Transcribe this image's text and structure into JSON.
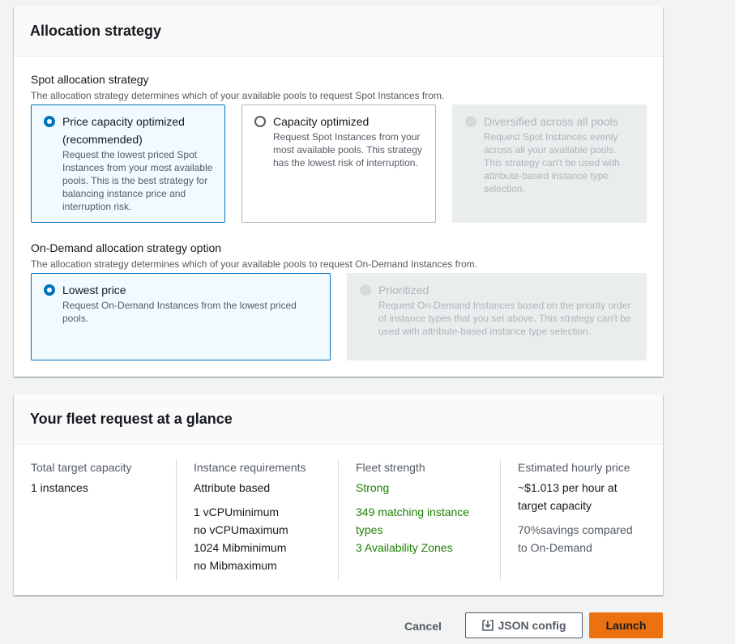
{
  "allocation": {
    "header": "Allocation strategy",
    "spot": {
      "label": "Spot allocation strategy",
      "description": "The allocation strategy determines which of your available pools to request Spot Instances from.",
      "options": [
        {
          "title_line1": "Price capacity optimized",
          "title_line2": "(recommended)",
          "description": "Request the lowest priced Spot Instances from your most available pools. This is the best strategy for balancing instance price and interruption risk.",
          "state": "selected"
        },
        {
          "title_line1": "Capacity optimized",
          "description": "Request Spot Instances from your most available pools. This strategy has the lowest risk of interruption.",
          "state": "unselected"
        },
        {
          "title_line1": "Diversified across all pools",
          "description": "Request Spot Instances evenly across all your available pools. This strategy can't be used with attribute-based instance type selection.",
          "state": "disabled"
        }
      ]
    },
    "ondemand": {
      "label": "On-Demand allocation strategy option",
      "description": "The allocation strategy determines which of your available pools to request On-Demand Instances from.",
      "options": [
        {
          "title_line1": "Lowest price",
          "description": "Request On-Demand Instances from the lowest priced pools.",
          "state": "selected"
        },
        {
          "title_line1": "Prioritized",
          "description": "Request On-Demand Instances based on the priority order of instance types that you set above. This strategy can't be used with attribute-based instance type selection.",
          "state": "disabled"
        }
      ]
    }
  },
  "glance": {
    "header": "Your fleet request at a glance",
    "total": {
      "label": "Total target capacity",
      "value": "1 instances"
    },
    "requirements": {
      "label": "Instance requirements",
      "value": "Attribute based",
      "lines": [
        "1 vCPUminimum",
        "no vCPUmaximum",
        "1024 Mibminimum",
        "no Mibmaximum"
      ]
    },
    "strength": {
      "label": "Fleet strength",
      "value": "Strong",
      "match_line1": "349 matching instance",
      "match_line2": "types",
      "zones": "3 Availability Zones"
    },
    "price": {
      "label": "Estimated hourly price",
      "line1": "~$1.013 per hour at",
      "line2": "target capacity",
      "savings1": "70%savings compared",
      "savings2": "to On-Demand"
    }
  },
  "footer": {
    "cancel": "Cancel",
    "json_config": "JSON config",
    "launch": "Launch",
    "json_icon": "export-icon"
  },
  "colors": {
    "accent": "#0073bb",
    "primary_button": "#ec7211",
    "success": "#1d8102"
  }
}
